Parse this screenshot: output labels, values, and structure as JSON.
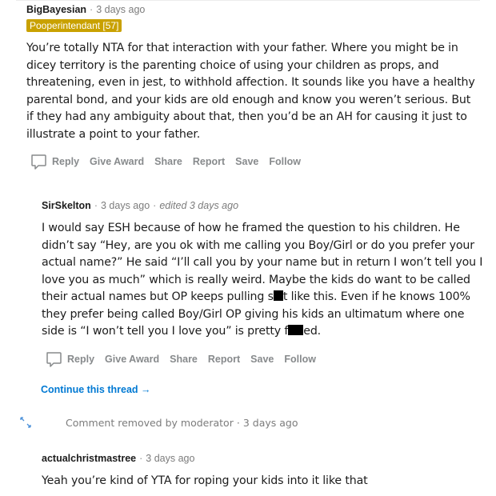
{
  "comments": [
    {
      "author": "BigBayesian",
      "time": "3 days ago",
      "flair": "Pooperintendant [57]",
      "body_lines": [
        "You’re totally NTA for that interaction with your father. Where you might be in",
        "dicey territory is the parenting choice of using your children as props, and",
        "threatening, even in jest, to withhold affection. It sounds like you have a healthy",
        "parental bond, and your kids are old enough and know you weren’t serious. But",
        "if they had any ambiguity about that, then you’d be an AH for causing it just to",
        "illustrate a point to your father."
      ],
      "actions": [
        "Reply",
        "Give Award",
        "Share",
        "Report",
        "Save",
        "Follow"
      ]
    },
    {
      "author": "SirSkelton",
      "time": "3 days ago",
      "edited": "edited 3 days ago",
      "body_lines": [
        "I would say ESH because of how he framed the question to his children. He",
        "didn’t say “Hey, are you ok with me calling you Boy/Girl or do you prefer your",
        "actual name?” He said “I’ll call you by your name but in return I won’t tell you I",
        "love you as much” which is really weird. Maybe the kids do want to be called",
        "their actual names but OP keeps pulling s",
        "t like this. Even if he knows 100%",
        "they prefer being called Boy/Girl OP giving his kids an ultimatum where one",
        "side is “I won’t tell you I love you” is pretty f",
        "ed."
      ],
      "actions": [
        "Reply",
        "Give Award",
        "Share",
        "Report",
        "Save",
        "Follow"
      ],
      "continue_thread": "Continue this thread"
    },
    {
      "removed_text": "Comment removed by moderator",
      "time": "3 days ago"
    },
    {
      "author": "actualchristmastree",
      "time": "3 days ago",
      "body": "Yeah you’re kind of YTA for roping your kids into it like that"
    }
  ],
  "colors": {
    "flair_bg": "#c9a100",
    "link": "#0079d3",
    "muted": "#878a8c"
  }
}
